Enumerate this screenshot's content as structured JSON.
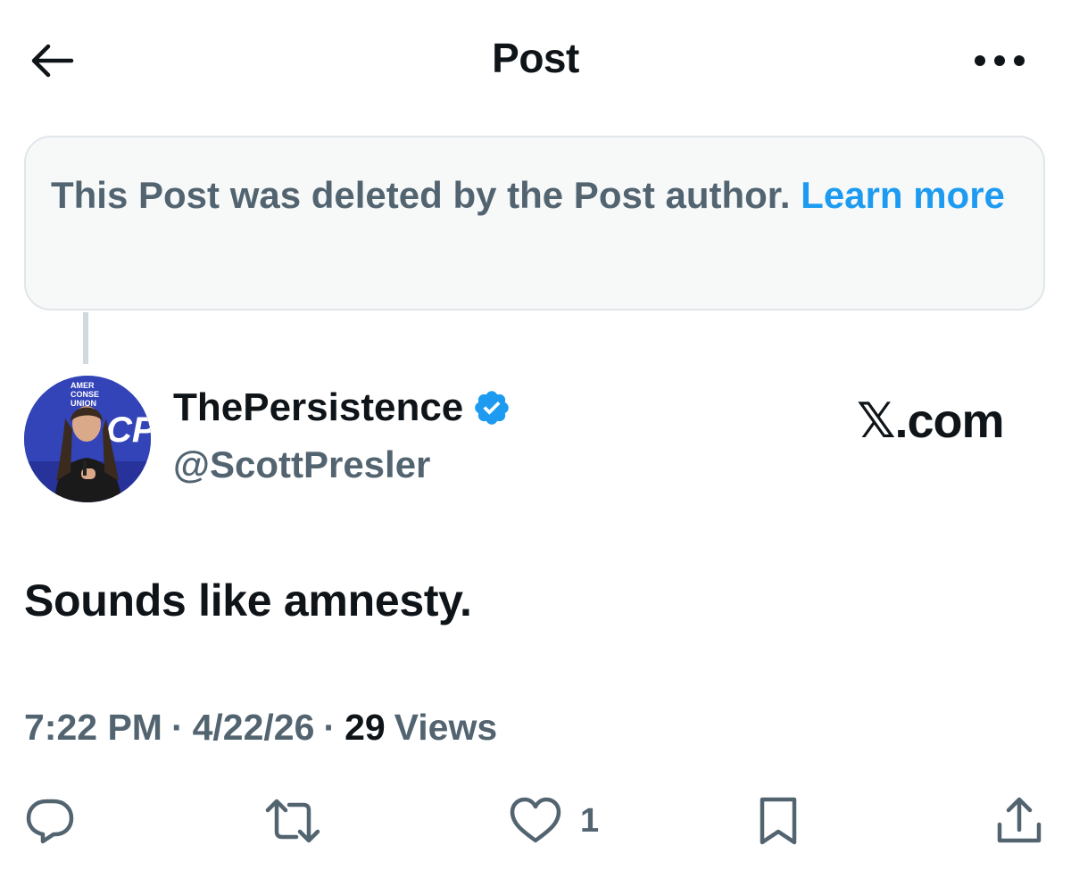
{
  "header": {
    "title": "Post",
    "back_icon": "arrow-left-icon",
    "more_icon": "more-horizontal-icon"
  },
  "deleted_notice": {
    "text": "This Post was deleted by the Post author.",
    "learn_more": "Learn more"
  },
  "author": {
    "avatar_badge_lines": [
      "AMER",
      "CONSE",
      "UNION",
      "CPA"
    ],
    "display_name": "ThePersistence",
    "verified_icon": "verified-badge-icon",
    "handle": "@ScottPresler",
    "source": "𝕏.com"
  },
  "post": {
    "text": "Sounds like amnesty."
  },
  "meta": {
    "time": "7:22 PM",
    "separator": "·",
    "date": "4/22/26",
    "views_count": "29",
    "views_label": "Views"
  },
  "actions": {
    "reply_icon": "reply-icon",
    "repost_icon": "repost-icon",
    "like_icon": "heart-icon",
    "like_count": "1",
    "bookmark_icon": "bookmark-icon",
    "share_icon": "share-icon"
  },
  "colors": {
    "text_primary": "#0f1419",
    "text_secondary": "#536471",
    "link": "#1d9bf0",
    "notice_bg": "#f7f9f9",
    "notice_border": "#e1e6ea"
  }
}
